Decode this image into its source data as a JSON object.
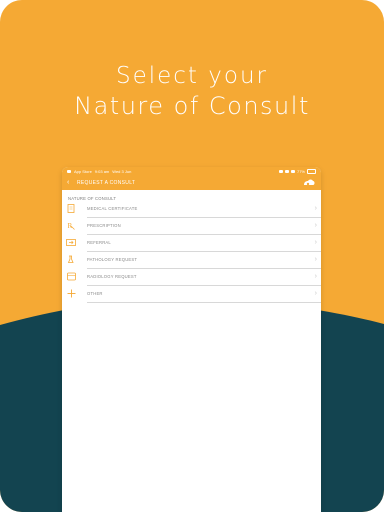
{
  "headline": {
    "line1": "Select your",
    "line2": "Nature of Consult"
  },
  "colors": {
    "accent": "#f5a934",
    "dark": "#134450",
    "white": "#ffffff"
  },
  "device": {
    "statusbar": {
      "left": "App Store",
      "time": "9:03 am",
      "date": "Wed 3 Jun",
      "battery": "77%"
    },
    "navbar": {
      "title": "REQUEST A CONSULT",
      "back_icon": "chevron-left-icon",
      "logo_icon": "brand-logo-icon"
    },
    "section_label": "NATURE OF CONSULT",
    "items": [
      {
        "label": "MEDICAL CERTIFICATE",
        "icon": "certificate-icon"
      },
      {
        "label": "PRESCRIPTION",
        "icon": "rx-icon"
      },
      {
        "label": "REFERRAL",
        "icon": "referral-icon"
      },
      {
        "label": "PATHOLOGY REQUEST",
        "icon": "pathology-icon"
      },
      {
        "label": "RADIOLOGY REQUEST",
        "icon": "radiology-icon"
      },
      {
        "label": "OTHER",
        "icon": "plus-icon"
      }
    ]
  }
}
